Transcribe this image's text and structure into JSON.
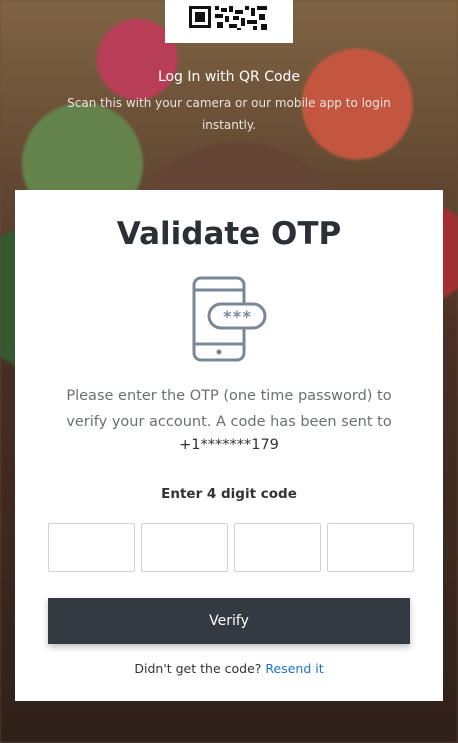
{
  "qr": {
    "title": "Log In with QR Code",
    "subtitle": "Scan this with your camera or our mobile app to login instantly."
  },
  "otp_card": {
    "title": "Validate OTP",
    "phone_icon": "phone-otp-icon",
    "description": "Please enter the OTP (one time password) to verify your account. A code has been sent to",
    "phone_number": "+1*******179",
    "digit_label": "Enter 4 digit code",
    "inputs": [
      "",
      "",
      "",
      ""
    ],
    "verify_label": "Verify",
    "resend_prompt": "Didn't get the code?",
    "resend_link": "Resend it"
  },
  "colors": {
    "button_bg": "#343a42",
    "link": "#1a73c9",
    "icon": "#7a8797"
  }
}
